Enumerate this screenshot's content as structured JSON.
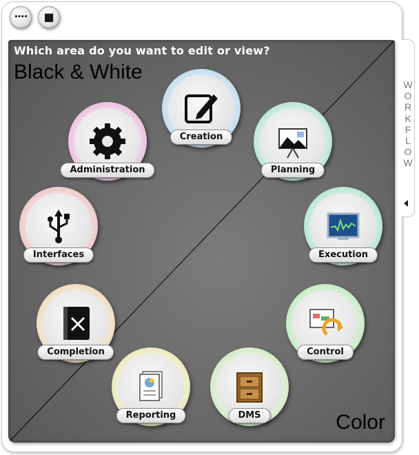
{
  "toolbar": {
    "more_button": {
      "glyph": "••••",
      "icon": "more-dots-icon"
    },
    "stop_button": {
      "glyph": "■",
      "icon": "stop-icon"
    }
  },
  "panel": {
    "question": "Which area do you want to edit or view?",
    "mode_bw_label": "Black & White",
    "mode_color_label": "Color"
  },
  "areas": [
    {
      "label": "Creation",
      "icon": "edit-icon",
      "ring_color": "#9cc3dc"
    },
    {
      "label": "Planning",
      "icon": "presentation-chart-icon",
      "ring_color": "#8fd2c0"
    },
    {
      "label": "Execution",
      "icon": "monitor-waveform-icon",
      "ring_color": "#86d4b0"
    },
    {
      "label": "Control",
      "icon": "control-cycle-icon",
      "ring_color": "#9fdca0"
    },
    {
      "label": "DMS",
      "icon": "file-cabinet-icon",
      "ring_color": "#b9dca6"
    },
    {
      "label": "Reporting",
      "icon": "report-document-icon",
      "ring_color": "#d9d98f"
    },
    {
      "label": "Completion",
      "icon": "closed-book-icon",
      "ring_color": "#e2c79a"
    },
    {
      "label": "Interfaces",
      "icon": "usb-icon",
      "ring_color": "#e0a6a8"
    },
    {
      "label": "Administration",
      "icon": "gear-icon",
      "ring_color": "#dc9dc8"
    }
  ],
  "side_panel": {
    "letters": [
      "W",
      "O",
      "R",
      "K",
      "F",
      "L",
      "O",
      "W"
    ],
    "collapse_icon": "collapse-left-icon"
  }
}
